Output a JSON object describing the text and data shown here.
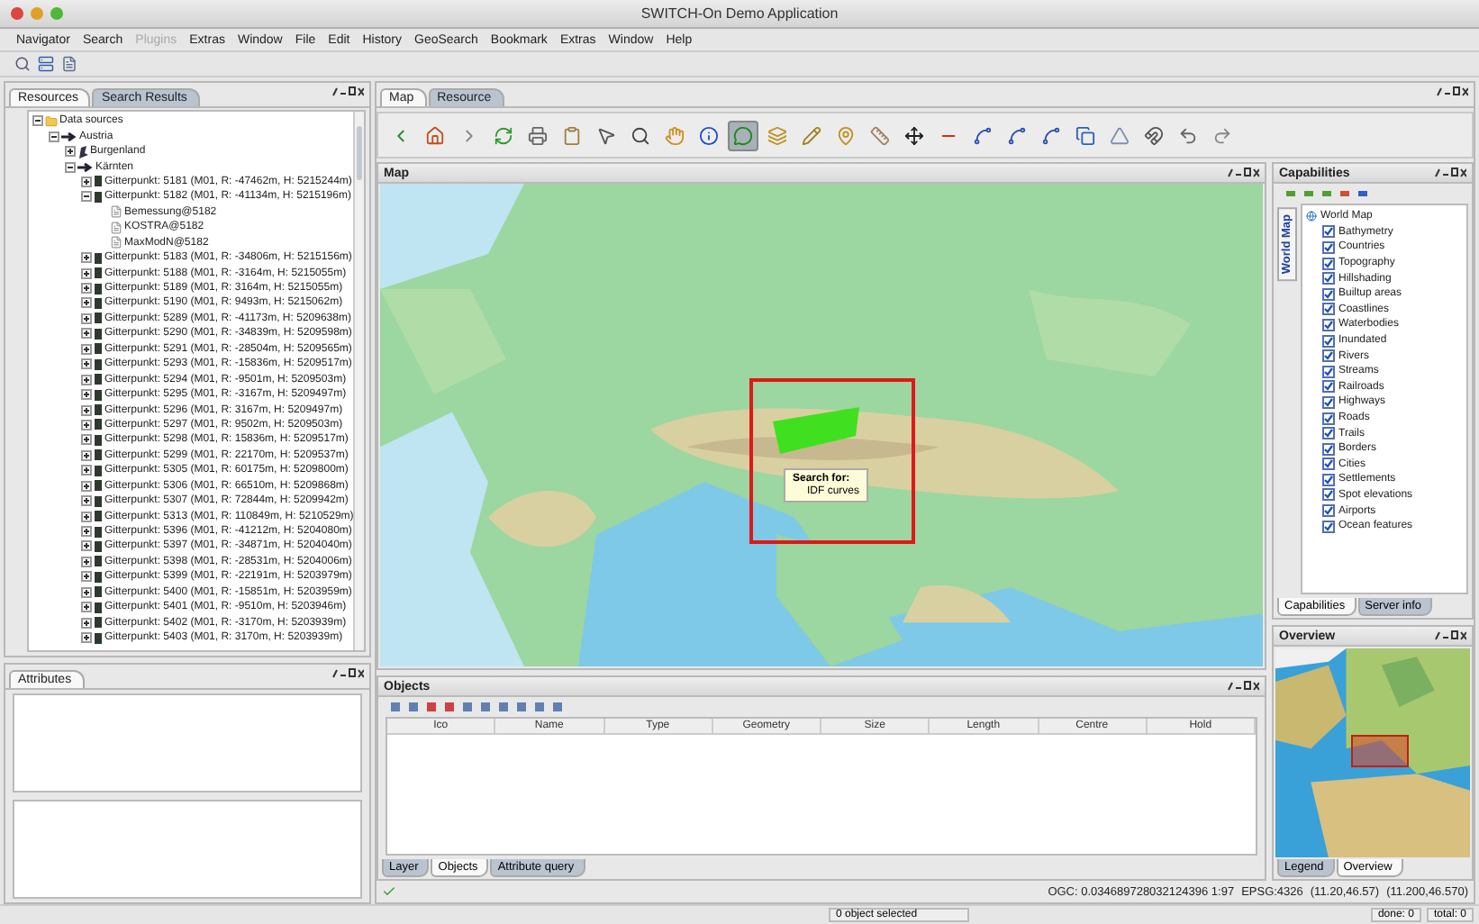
{
  "window": {
    "title": "SWITCH-On Demo Application"
  },
  "menu": [
    {
      "label": "Navigator",
      "disabled": false
    },
    {
      "label": "Search",
      "disabled": false
    },
    {
      "label": "Plugins",
      "disabled": true
    },
    {
      "label": "Extras",
      "disabled": false
    },
    {
      "label": "Window",
      "disabled": false
    },
    {
      "label": "File",
      "disabled": false
    },
    {
      "label": "Edit",
      "disabled": false
    },
    {
      "label": "History",
      "disabled": false
    },
    {
      "label": "GeoSearch",
      "disabled": false
    },
    {
      "label": "Bookmark",
      "disabled": false
    },
    {
      "label": "Extras",
      "disabled": false
    },
    {
      "label": "Window",
      "disabled": false
    },
    {
      "label": "Help",
      "disabled": false
    }
  ],
  "left_tabs": [
    {
      "label": "Resources",
      "selected": true
    },
    {
      "label": "Search Results",
      "selected": false
    }
  ],
  "resources_tree": [
    {
      "label": "Data sources",
      "kind": "folder",
      "expanded": true,
      "children": [
        {
          "label": "Austria",
          "kind": "country",
          "expanded": true,
          "children": [
            {
              "label": "Burgenland",
              "kind": "region",
              "expanded": false
            },
            {
              "label": "Kärnten",
              "kind": "country",
              "expanded": true,
              "children": [
                {
                  "label": "Gitterpunkt: 5181 (M01, R: -47462m, H: 5215244m)",
                  "kind": "point",
                  "expanded": false
                },
                {
                  "label": "Gitterpunkt: 5182 (M01, R: -41134m, H: 5215196m)",
                  "kind": "point",
                  "expanded": true,
                  "children": [
                    {
                      "label": "Bemessung@5182",
                      "kind": "dataset"
                    },
                    {
                      "label": "KOSTRA@5182",
                      "kind": "dataset"
                    },
                    {
                      "label": "MaxModN@5182",
                      "kind": "dataset"
                    }
                  ]
                },
                {
                  "label": "Gitterpunkt: 5183 (M01, R: -34806m, H: 5215156m)",
                  "kind": "point",
                  "expanded": false
                },
                {
                  "label": "Gitterpunkt: 5188 (M01, R: -3164m, H: 5215055m)",
                  "kind": "point",
                  "expanded": false
                },
                {
                  "label": "Gitterpunkt: 5189 (M01, R: 3164m, H: 5215055m)",
                  "kind": "point",
                  "expanded": false
                },
                {
                  "label": "Gitterpunkt: 5190 (M01, R: 9493m, H: 5215062m)",
                  "kind": "point",
                  "expanded": false
                },
                {
                  "label": "Gitterpunkt: 5289 (M01, R: -41173m, H: 5209638m)",
                  "kind": "point",
                  "expanded": false
                },
                {
                  "label": "Gitterpunkt: 5290 (M01, R: -34839m, H: 5209598m)",
                  "kind": "point",
                  "expanded": false
                },
                {
                  "label": "Gitterpunkt: 5291 (M01, R: -28504m, H: 5209565m)",
                  "kind": "point",
                  "expanded": false
                },
                {
                  "label": "Gitterpunkt: 5293 (M01, R: -15836m, H: 5209517m)",
                  "kind": "point",
                  "expanded": false
                },
                {
                  "label": "Gitterpunkt: 5294 (M01, R: -9501m, H: 5209503m)",
                  "kind": "point",
                  "expanded": false
                },
                {
                  "label": "Gitterpunkt: 5295 (M01, R: -3167m, H: 5209497m)",
                  "kind": "point",
                  "expanded": false
                },
                {
                  "label": "Gitterpunkt: 5296 (M01, R: 3167m, H: 5209497m)",
                  "kind": "point",
                  "expanded": false
                },
                {
                  "label": "Gitterpunkt: 5297 (M01, R: 9502m, H: 5209503m)",
                  "kind": "point",
                  "expanded": false
                },
                {
                  "label": "Gitterpunkt: 5298 (M01, R: 15836m, H: 5209517m)",
                  "kind": "point",
                  "expanded": false
                },
                {
                  "label": "Gitterpunkt: 5299 (M01, R: 22170m, H: 5209537m)",
                  "kind": "point",
                  "expanded": false
                },
                {
                  "label": "Gitterpunkt: 5305 (M01, R: 60175m, H: 5209800m)",
                  "kind": "point",
                  "expanded": false
                },
                {
                  "label": "Gitterpunkt: 5306 (M01, R: 66510m, H: 5209868m)",
                  "kind": "point",
                  "expanded": false
                },
                {
                  "label": "Gitterpunkt: 5307 (M01, R: 72844m, H: 5209942m)",
                  "kind": "point",
                  "expanded": false
                },
                {
                  "label": "Gitterpunkt: 5313 (M01, R: 110849m, H: 5210529m)",
                  "kind": "point",
                  "expanded": false
                },
                {
                  "label": "Gitterpunkt: 5396 (M01, R: -41212m, H: 5204080m)",
                  "kind": "point",
                  "expanded": false
                },
                {
                  "label": "Gitterpunkt: 5397 (M01, R: -34871m, H: 5204040m)",
                  "kind": "point",
                  "expanded": false
                },
                {
                  "label": "Gitterpunkt: 5398 (M01, R: -28531m, H: 5204006m)",
                  "kind": "point",
                  "expanded": false
                },
                {
                  "label": "Gitterpunkt: 5399 (M01, R: -22191m, H: 5203979m)",
                  "kind": "point",
                  "expanded": false
                },
                {
                  "label": "Gitterpunkt: 5400 (M01, R: -15851m, H: 5203959m)",
                  "kind": "point",
                  "expanded": false
                },
                {
                  "label": "Gitterpunkt: 5401 (M01, R: -9510m, H: 5203946m)",
                  "kind": "point",
                  "expanded": false
                },
                {
                  "label": "Gitterpunkt: 5402 (M01, R: -3170m, H: 5203939m)",
                  "kind": "point",
                  "expanded": false
                },
                {
                  "label": "Gitterpunkt: 5403 (M01, R: 3170m, H: 5203939m)",
                  "kind": "point",
                  "expanded": false
                }
              ]
            }
          ]
        }
      ]
    }
  ],
  "attributes_panel": {
    "title": "Attributes"
  },
  "map_tabs": [
    {
      "label": "Map",
      "selected": true
    },
    {
      "label": "Resource",
      "selected": false
    }
  ],
  "map_toolbar": [
    {
      "kind": "back",
      "selected": false
    },
    {
      "kind": "home",
      "selected": false
    },
    {
      "kind": "forward",
      "selected": false
    },
    {
      "kind": "refresh",
      "selected": false
    },
    {
      "kind": "print",
      "selected": false
    },
    {
      "kind": "clipboard",
      "selected": false
    },
    {
      "kind": "pointer",
      "selected": false
    },
    {
      "kind": "zoom",
      "selected": false
    },
    {
      "kind": "pan",
      "selected": false
    },
    {
      "kind": "info",
      "selected": false
    },
    {
      "kind": "search-geometry",
      "selected": true
    },
    {
      "kind": "layers",
      "selected": false
    },
    {
      "kind": "edit",
      "selected": false
    },
    {
      "kind": "pin",
      "selected": false
    },
    {
      "kind": "measure",
      "selected": false
    },
    {
      "kind": "move",
      "selected": false
    },
    {
      "kind": "remove",
      "selected": false
    },
    {
      "kind": "line",
      "selected": false
    },
    {
      "kind": "line",
      "selected": false
    },
    {
      "kind": "line",
      "selected": false
    },
    {
      "kind": "copy",
      "selected": false
    },
    {
      "kind": "triangle",
      "selected": false
    },
    {
      "kind": "snap",
      "selected": false
    },
    {
      "kind": "undo",
      "selected": false
    },
    {
      "kind": "redo",
      "selected": false
    }
  ],
  "map_panel": {
    "title": "Map",
    "tooltip": {
      "title": "Search for:",
      "item": "IDF curves"
    }
  },
  "objects_panel": {
    "title": "Objects",
    "columns": [
      "Ico",
      "Name",
      "Type",
      "Geometry",
      "Size",
      "Length",
      "Centre",
      "Hold"
    ]
  },
  "bottom_tabs": [
    {
      "label": "Layer",
      "selected": false
    },
    {
      "label": "Objects",
      "selected": true
    },
    {
      "label": "Attribute query",
      "selected": false
    }
  ],
  "capabilities_panel": {
    "title": "Capabilities",
    "side_tab": "World Map",
    "root": "World Map",
    "layers": [
      {
        "label": "Bathymetry",
        "checked": true
      },
      {
        "label": "Countries",
        "checked": true
      },
      {
        "label": "Topography",
        "checked": true
      },
      {
        "label": "Hillshading",
        "checked": true
      },
      {
        "label": "Builtup areas",
        "checked": true
      },
      {
        "label": "Coastlines",
        "checked": true
      },
      {
        "label": "Waterbodies",
        "checked": true
      },
      {
        "label": "Inundated",
        "checked": true
      },
      {
        "label": "Rivers",
        "checked": true
      },
      {
        "label": "Streams",
        "checked": true
      },
      {
        "label": "Railroads",
        "checked": true
      },
      {
        "label": "Highways",
        "checked": true
      },
      {
        "label": "Roads",
        "checked": true
      },
      {
        "label": "Trails",
        "checked": true
      },
      {
        "label": "Borders",
        "checked": true
      },
      {
        "label": "Cities",
        "checked": true
      },
      {
        "label": "Settlements",
        "checked": true
      },
      {
        "label": "Spot elevations",
        "checked": true
      },
      {
        "label": "Airports",
        "checked": true
      },
      {
        "label": "Ocean features",
        "checked": true
      }
    ]
  },
  "capabilities_tabs": [
    {
      "label": "Capabilities",
      "selected": true
    },
    {
      "label": "Server info",
      "selected": false
    }
  ],
  "overview_panel": {
    "title": "Overview"
  },
  "overview_tabs": [
    {
      "label": "Legend",
      "selected": false
    },
    {
      "label": "Overview",
      "selected": true
    }
  ],
  "status_line": {
    "scale": "OGC: 0.034689728032124396 1:97",
    "crs": "EPSG:4326",
    "coords": "(11.20,46.57)",
    "coords_precise": "(11.200,46.570)"
  },
  "status_bar": {
    "selection": "0 object selected",
    "done": "done: 0",
    "total": "total: 0"
  }
}
